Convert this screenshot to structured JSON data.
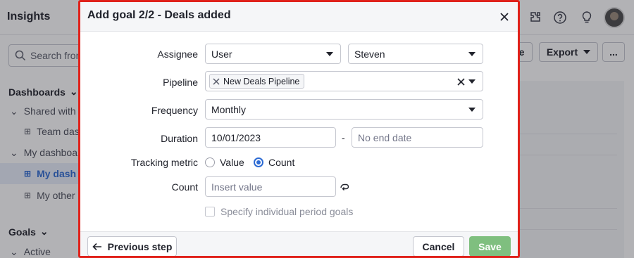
{
  "app": {
    "title": "Insights",
    "search_placeholder": "Search fron",
    "sidebar": {
      "dashboards_heading": "Dashboards",
      "items": [
        {
          "label": "Shared with"
        },
        {
          "label": "Team das"
        },
        {
          "label": "My dashboa"
        },
        {
          "label": "My dash"
        },
        {
          "label": "My other"
        }
      ],
      "goals_heading": "Goals",
      "goals_items": [
        {
          "label": "Active"
        }
      ]
    },
    "toolbar": {
      "partial_label": "e",
      "export_label": "Export",
      "more_label": "..."
    }
  },
  "modal": {
    "title": "Add goal 2/2 - Deals added",
    "assignee": {
      "label": "Assignee",
      "type_value": "User",
      "user_value": "Steven"
    },
    "pipeline": {
      "label": "Pipeline",
      "chip": "New Deals Pipeline"
    },
    "frequency": {
      "label": "Frequency",
      "value": "Monthly"
    },
    "duration": {
      "label": "Duration",
      "start": "10/01/2023",
      "separator": "-",
      "end_placeholder": "No end date"
    },
    "tracking_metric": {
      "label": "Tracking metric",
      "options": [
        {
          "label": "Value",
          "checked": false
        },
        {
          "label": "Count",
          "checked": true
        }
      ]
    },
    "count": {
      "label": "Count",
      "placeholder": "Insert value"
    },
    "period_goals": {
      "label": "Specify individual period goals",
      "checked": false
    },
    "footer": {
      "previous_label": "Previous step",
      "cancel_label": "Cancel",
      "save_label": "Save"
    }
  },
  "colors": {
    "accent_blue": "#2d6bd3",
    "save_green": "#7fbf7f",
    "highlight_border": "#e0221b"
  }
}
